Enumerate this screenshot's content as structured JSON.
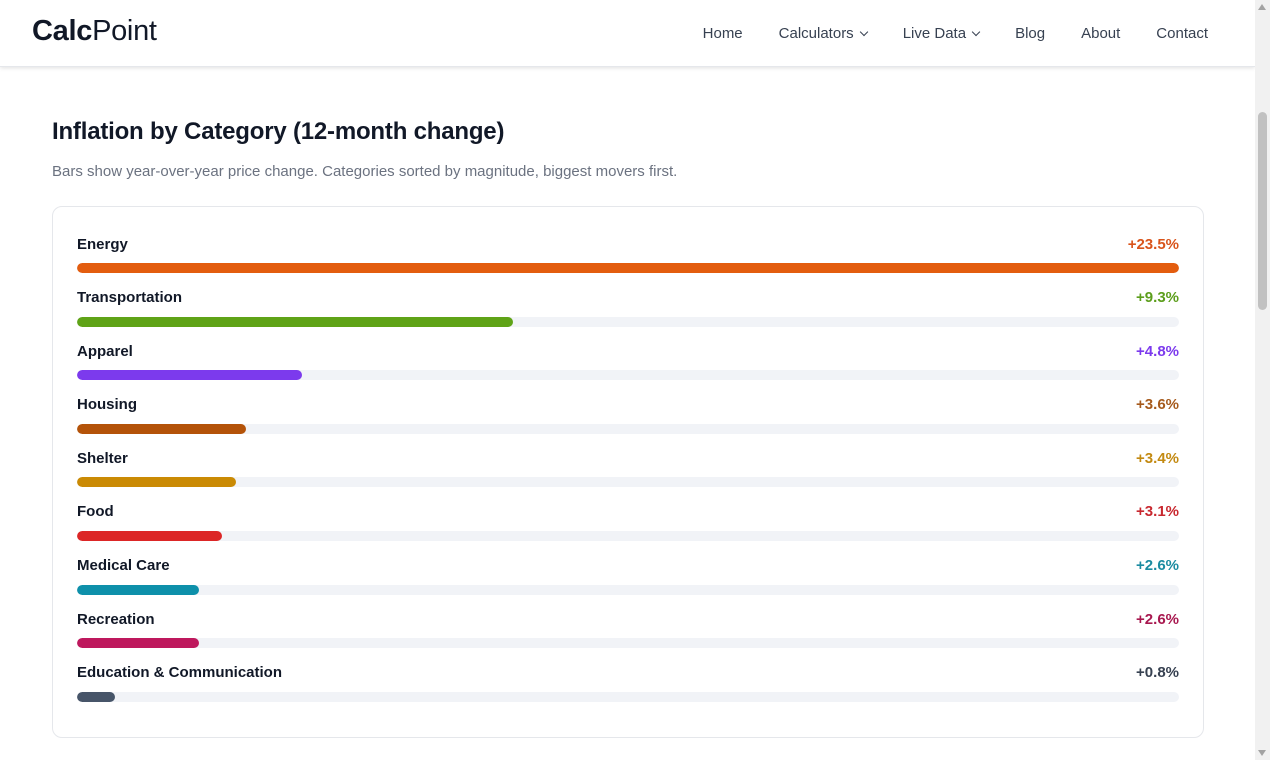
{
  "header": {
    "logo_bold": "Calc",
    "logo_regular": "Point",
    "nav": [
      {
        "label": "Home",
        "dropdown": false
      },
      {
        "label": "Calculators",
        "dropdown": true
      },
      {
        "label": "Live Data",
        "dropdown": true
      },
      {
        "label": "Blog",
        "dropdown": false
      },
      {
        "label": "About",
        "dropdown": false
      },
      {
        "label": "Contact",
        "dropdown": false
      }
    ]
  },
  "main": {
    "title": "Inflation by Category (12-month change)",
    "subtitle": "Bars show year-over-year price change. Categories sorted by magnitude, biggest movers first."
  },
  "chart_data": {
    "type": "bar",
    "orientation": "horizontal",
    "max_value": 23.5,
    "categories": [
      "Energy",
      "Transportation",
      "Apparel",
      "Housing",
      "Shelter",
      "Food",
      "Medical Care",
      "Recreation",
      "Education & Communication"
    ],
    "values": [
      23.5,
      9.3,
      4.8,
      3.6,
      3.4,
      3.1,
      2.6,
      2.6,
      0.8
    ],
    "value_labels": [
      "+23.5%",
      "+9.3%",
      "+4.8%",
      "+3.6%",
      "+3.4%",
      "+3.1%",
      "+2.6%",
      "+2.6%",
      "+0.8%"
    ],
    "colors": [
      "#e35d0f",
      "#5fa317",
      "#7c3aed",
      "#b45309",
      "#ca8a04",
      "#dc2626",
      "#0e90aa",
      "#be185d",
      "#475569"
    ],
    "value_colors": [
      "#d9541b",
      "#5c9e1c",
      "#7c3aed",
      "#a65a1c",
      "#c38a12",
      "#c8282f",
      "#1b8ba1",
      "#a8184f",
      "#374151"
    ],
    "track_color": "#f1f3f7"
  }
}
